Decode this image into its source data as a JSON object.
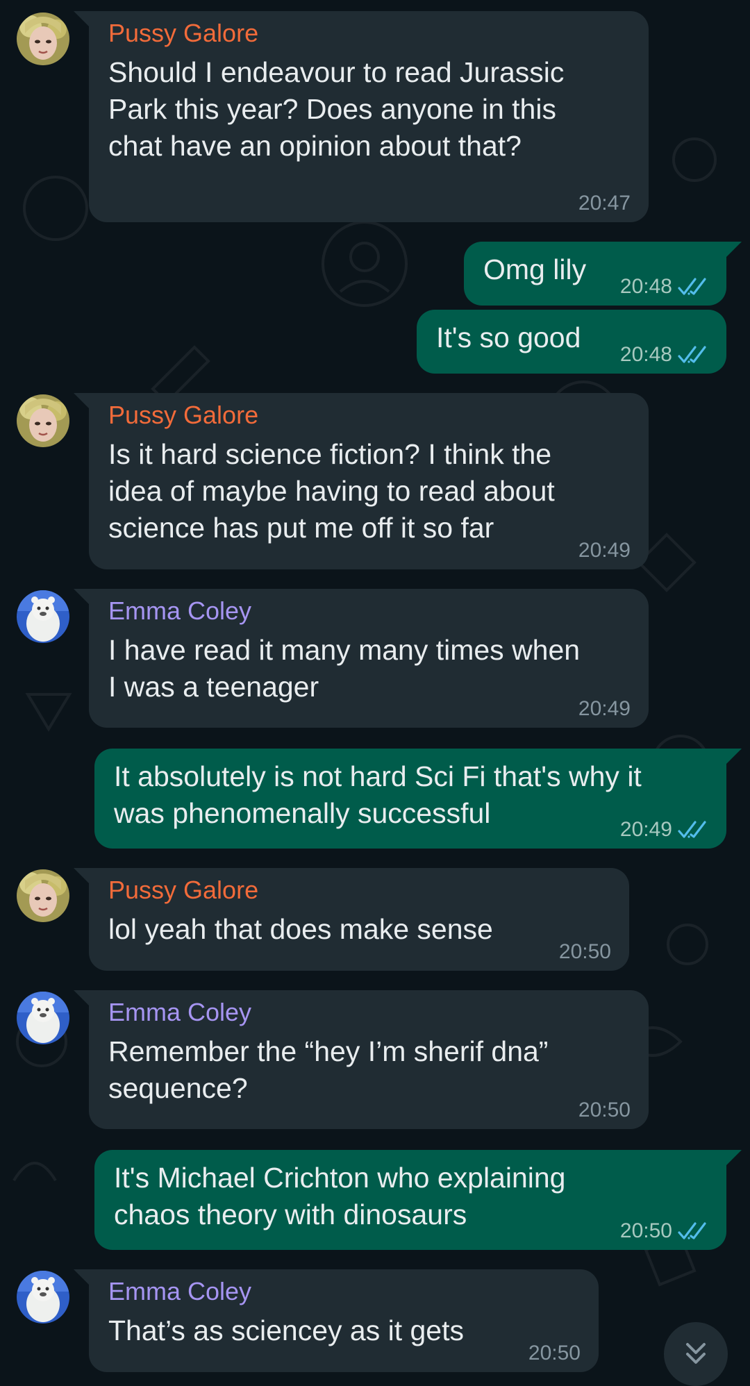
{
  "colors": {
    "background": "#0b141a",
    "incoming_bubble": "#202c33",
    "outgoing_bubble": "#005c4b",
    "sender_pussy_galore": "#f26b3a",
    "sender_emma_coley": "#a695f2",
    "read_ticks": "#53bdeb",
    "timestamp": "#8696a0"
  },
  "messages": [
    {
      "direction": "incoming",
      "sender": "Pussy Galore",
      "avatar": "avatar-pussy-galore",
      "lines": [
        "Should I endeavour to read Jurassic",
        "Park this year? Does anyone in this",
        "chat have an opinion about that?"
      ],
      "time": "20:47"
    },
    {
      "direction": "outgoing",
      "lines": [
        "Omg lily"
      ],
      "time": "20:48",
      "status": "read-double-check-icon"
    },
    {
      "direction": "outgoing",
      "lines": [
        "It's so good"
      ],
      "time": "20:48",
      "status": "read-double-check-icon"
    },
    {
      "direction": "incoming",
      "sender": "Pussy Galore",
      "avatar": "avatar-pussy-galore",
      "lines": [
        "Is it hard science fiction? I think the",
        "idea of maybe having to read about",
        "science has put me off it so far"
      ],
      "time": "20:49"
    },
    {
      "direction": "incoming",
      "sender": "Emma Coley",
      "avatar": "avatar-emma-coley",
      "lines": [
        "I have read it many many times when",
        "I was a teenager"
      ],
      "time": "20:49"
    },
    {
      "direction": "outgoing",
      "lines": [
        "It absolutely is not hard Sci Fi that's why it",
        "was phenomenally successful"
      ],
      "time": "20:49",
      "status": "read-double-check-icon"
    },
    {
      "direction": "incoming",
      "sender": "Pussy Galore",
      "avatar": "avatar-pussy-galore",
      "lines": [
        "lol yeah that does make sense"
      ],
      "time": "20:50"
    },
    {
      "direction": "incoming",
      "sender": "Emma Coley",
      "avatar": "avatar-emma-coley",
      "lines": [
        "Remember the “hey I’m sherif dna”",
        "sequence?"
      ],
      "time": "20:50"
    },
    {
      "direction": "outgoing",
      "lines": [
        "It's Michael Crichton who explaining",
        "chaos theory with dinosaurs"
      ],
      "time": "20:50",
      "status": "read-double-check-icon"
    },
    {
      "direction": "incoming",
      "sender": "Emma Coley",
      "avatar": "avatar-emma-coley",
      "lines": [
        "That’s as sciencey as it gets"
      ],
      "time": "20:50"
    }
  ],
  "scroll_button": {
    "icon": "double-chevron-down-icon"
  }
}
